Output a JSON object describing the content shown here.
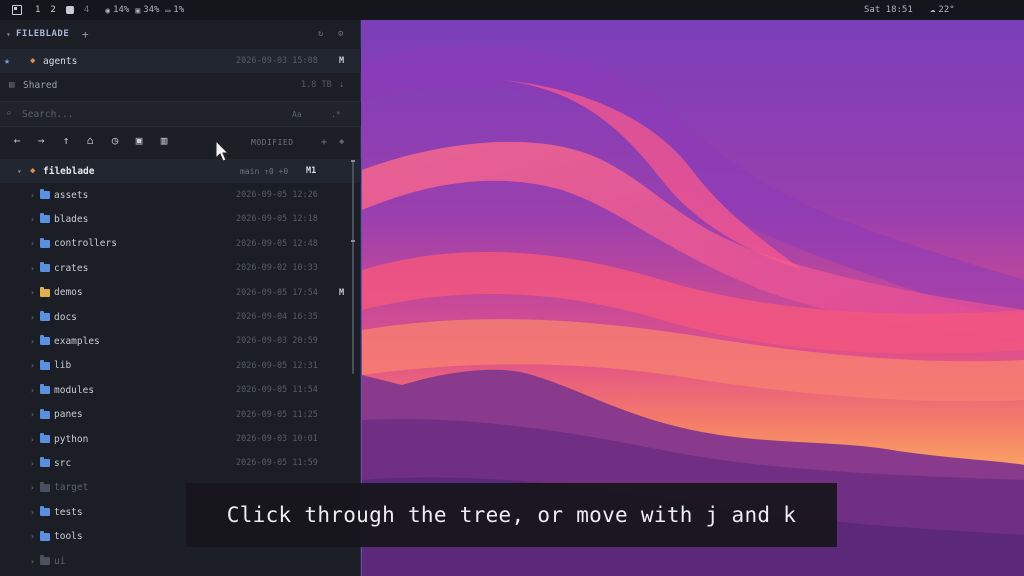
{
  "topbar": {
    "workspaces": [
      "1",
      "2",
      "4"
    ],
    "cpu": "14%",
    "mem": "34%",
    "bat": "1%",
    "clock": "Sat 18:51",
    "weather": "22°"
  },
  "sidebar": {
    "title": "FILEBLADE",
    "favorite": {
      "name": "agents",
      "date": "2026-09-03 15:08",
      "mark": "M"
    },
    "shared": {
      "name": "Shared",
      "size": "1.8 TB"
    },
    "search": {
      "placeholder": "Search...",
      "opt1": "Aa",
      "opt2": ".*"
    },
    "column_label": "MODIFIED",
    "root": {
      "name": "fileblade",
      "git": "main ↑0 +0",
      "mark": "M1"
    },
    "items": [
      {
        "name": "assets",
        "date": "2026-09-05 12:26",
        "mark": ""
      },
      {
        "name": "blades",
        "date": "2026-09-05 12:18",
        "mark": ""
      },
      {
        "name": "controllers",
        "date": "2026-09-05 12:48",
        "mark": ""
      },
      {
        "name": "crates",
        "date": "2026-09-02 10:33",
        "mark": ""
      },
      {
        "name": "demos",
        "date": "2026-09-05 17:54",
        "mark": "M"
      },
      {
        "name": "docs",
        "date": "2026-09-04 16:35",
        "mark": ""
      },
      {
        "name": "examples",
        "date": "2026-09-03 20:59",
        "mark": ""
      },
      {
        "name": "lib",
        "date": "2026-09-05 12:31",
        "mark": ""
      },
      {
        "name": "modules",
        "date": "2026-09-05 11:54",
        "mark": ""
      },
      {
        "name": "panes",
        "date": "2026-09-05 11:25",
        "mark": ""
      },
      {
        "name": "python",
        "date": "2026-09-03 10:01",
        "mark": ""
      },
      {
        "name": "src",
        "date": "2026-09-05 11:59",
        "mark": ""
      },
      {
        "name": "target",
        "date": "",
        "mark": ""
      },
      {
        "name": "tests",
        "date": "",
        "mark": ""
      },
      {
        "name": "tools",
        "date": "",
        "mark": ""
      },
      {
        "name": "ui",
        "date": "",
        "mark": ""
      }
    ]
  },
  "caption": "Click through the tree, or move with j and k",
  "colors": {
    "folder": "#5b8fe0",
    "folder_modified": "#e0b050",
    "accent": "#a8b4d8"
  }
}
